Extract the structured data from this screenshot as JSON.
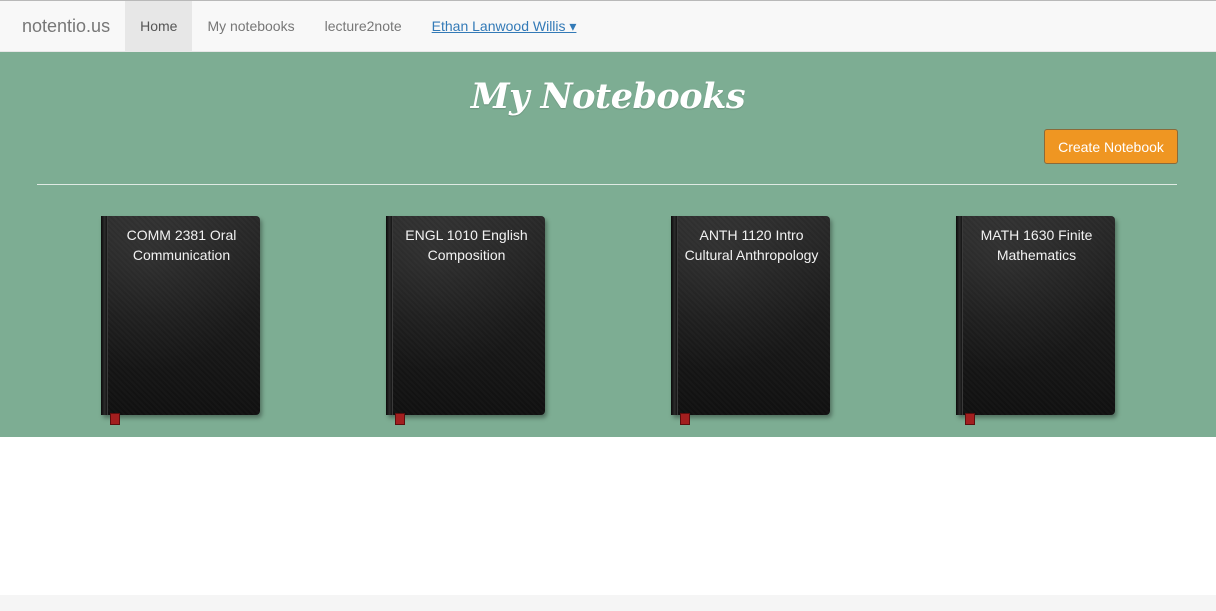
{
  "navbar": {
    "brand": "notentio.us",
    "items": [
      {
        "label": "Home",
        "active": true
      },
      {
        "label": "My notebooks",
        "active": false
      },
      {
        "label": "lecture2note",
        "active": false
      }
    ],
    "user": "Ethan Lanwood Willis ▾"
  },
  "hero": {
    "title": "My Notebooks",
    "create_button": "Create Notebook",
    "background_color": "#7dad93",
    "button_color": "#ef9622"
  },
  "notebooks": [
    {
      "title": "COMM 2381 Oral Communication"
    },
    {
      "title": "ENGL 1010 English Composition"
    },
    {
      "title": "ANTH 1120 Intro Cultural Anthropology"
    },
    {
      "title": "MATH 1630 Finite Mathematics"
    }
  ]
}
